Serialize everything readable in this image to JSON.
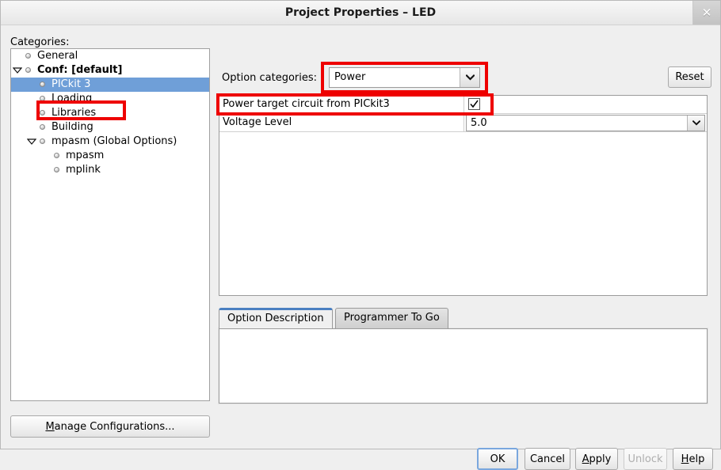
{
  "window": {
    "title": "Project Properties – LED",
    "close_label": "✕"
  },
  "sidebar": {
    "label": "Categories:",
    "items": [
      {
        "label": "General",
        "indent": 1,
        "twisty": "none",
        "bullet": true,
        "bold": false,
        "selected": false
      },
      {
        "label": "Conf: [default]",
        "indent": 1,
        "twisty": "expanded",
        "bullet": true,
        "bold": true,
        "selected": false
      },
      {
        "label": "PICkit 3",
        "indent": 2,
        "twisty": "none",
        "bullet": true,
        "bold": false,
        "selected": true
      },
      {
        "label": "Loading",
        "indent": 2,
        "twisty": "none",
        "bullet": true,
        "bold": false,
        "selected": false
      },
      {
        "label": "Libraries",
        "indent": 2,
        "twisty": "none",
        "bullet": true,
        "bold": false,
        "selected": false
      },
      {
        "label": "Building",
        "indent": 2,
        "twisty": "none",
        "bullet": true,
        "bold": false,
        "selected": false
      },
      {
        "label": "mpasm (Global Options)",
        "indent": 2,
        "twisty": "expanded",
        "bullet": true,
        "bold": false,
        "selected": false
      },
      {
        "label": "mpasm",
        "indent": 3,
        "twisty": "none",
        "bullet": true,
        "bold": false,
        "selected": false
      },
      {
        "label": "mplink",
        "indent": 3,
        "twisty": "none",
        "bullet": true,
        "bold": false,
        "selected": false
      }
    ],
    "manage_configurations_button": {
      "mnemonic": "M",
      "rest": "anage Configurations..."
    }
  },
  "main": {
    "option_categories_label": "Option categories:",
    "option_categories_value": "Power",
    "reset_button": "Reset",
    "options": [
      {
        "name": "Power target circuit from PICkit3",
        "type": "checkbox",
        "checked": true
      },
      {
        "name": "Voltage Level",
        "type": "combo",
        "value": "5.0"
      }
    ],
    "tabs": [
      {
        "label": "Option Description",
        "active": true
      },
      {
        "label": "Programmer To Go",
        "active": false
      }
    ],
    "description_text": ""
  },
  "footer": {
    "ok": {
      "label": "OK",
      "mnemonic": "",
      "rest": "OK",
      "disabled": false,
      "focused": true
    },
    "cancel": {
      "label": "Cancel",
      "mnemonic": "",
      "rest": "Cancel",
      "disabled": false,
      "focused": false
    },
    "apply": {
      "label": "Apply",
      "mnemonic": "A",
      "rest": "pply",
      "disabled": false,
      "focused": false
    },
    "unlock": {
      "label": "Unlock",
      "mnemonic": "",
      "rest": "Unlock",
      "disabled": true,
      "focused": false
    },
    "help": {
      "label": "Help",
      "mnemonic": "H",
      "rest": "elp",
      "disabled": false,
      "focused": false
    }
  },
  "annotations": {
    "highlight_color": "#ee0000",
    "boxes": [
      {
        "target": "option-categories-combo"
      },
      {
        "target": "sidebar-item-pickit-3"
      },
      {
        "target": "option-row-power-target"
      }
    ]
  }
}
